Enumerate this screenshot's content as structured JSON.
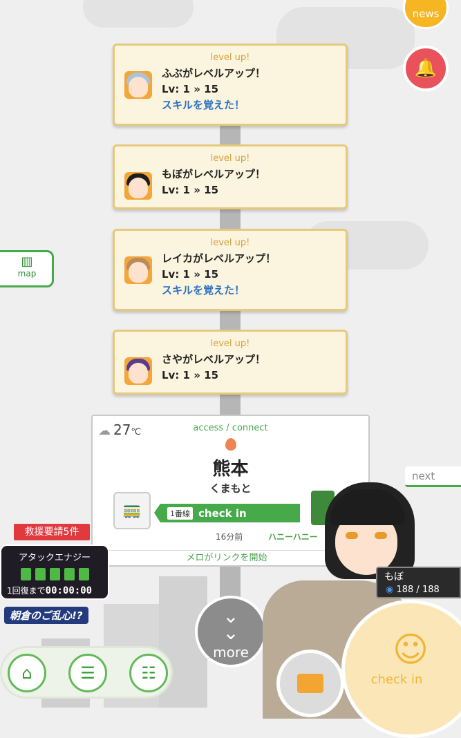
{
  "header": {
    "news_label": "news",
    "bell_icon": "bell-icon"
  },
  "side": {
    "map_label": "map",
    "map_icon": "map-icon"
  },
  "feed": [
    {
      "tag": "level up!",
      "message": "ふぶがレベルアップ！",
      "level": "Lv: 1 » 15",
      "skill": "スキルを覚えた！",
      "hair": "#a9c4d6"
    },
    {
      "tag": "level up!",
      "message": "もぼがレベルアップ！",
      "level": "Lv: 1 » 15",
      "skill": "",
      "hair": "#1d1d1d"
    },
    {
      "tag": "level up!",
      "message": "レイカがレベルアップ！",
      "level": "Lv: 1 » 15",
      "skill": "スキルを覚えた！",
      "hair": "#b98a5a"
    },
    {
      "tag": "level up!",
      "message": "さやがレベルアップ！",
      "level": "Lv: 1 » 15",
      "skill": "",
      "hair": "#5a3b8c"
    }
  ],
  "station": {
    "temperature": "27",
    "unit": "℃",
    "access": "access / connect",
    "name": "熊本",
    "kana": "くまもと",
    "line": "1番線",
    "checkin_label": "check in",
    "time_ago": "16分前",
    "user": "ハニーハニー",
    "link_status": "メロがリンクを開始"
  },
  "status": {
    "rescue": "救援要請5件",
    "energy_title": "アタックエナジー",
    "energy_recover_label": "1回復まで",
    "energy_timer": "00:00:00",
    "event_title": "朝倉のご乱心!?"
  },
  "nav": {
    "more_label": "more",
    "next_label": "next"
  },
  "character": {
    "name": "もぼ",
    "hp": "188 / 188"
  },
  "checkin_button_label": "check in",
  "colors": {
    "accent_green": "#46a94a",
    "news_orange": "#f6b523",
    "bell_red": "#e9525b",
    "card_bg": "#fbf4de",
    "skill_blue": "#2a6fc4"
  }
}
